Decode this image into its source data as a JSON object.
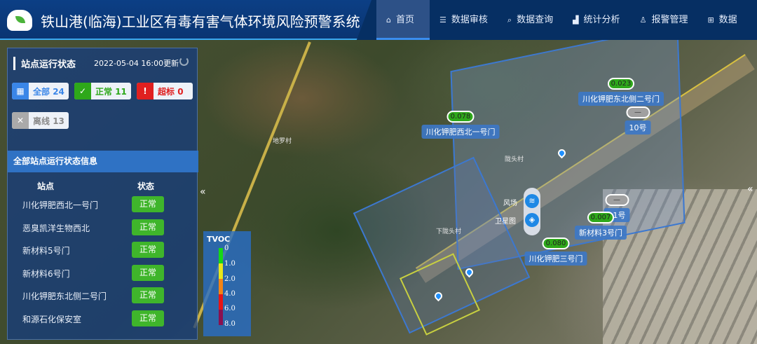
{
  "header": {
    "title": "铁山港(临海)工业区有毒有害气体环境风险预警系统",
    "nav": [
      {
        "label": "首页",
        "icon": "home-icon"
      },
      {
        "label": "数据审核",
        "icon": "list-icon"
      },
      {
        "label": "数据查询",
        "icon": "search-icon"
      },
      {
        "label": "统计分析",
        "icon": "chart-icon"
      },
      {
        "label": "报警管理",
        "icon": "alarm-icon"
      },
      {
        "label": "数据",
        "icon": "table-icon"
      }
    ]
  },
  "panel": {
    "title": "站点运行状态",
    "updated": "2022-05-04 16:00更新",
    "badges": {
      "all": {
        "label": "全部",
        "count": "24"
      },
      "normal": {
        "label": "正常",
        "count": "11"
      },
      "over": {
        "label": "超标",
        "count": "0"
      },
      "offline": {
        "label": "离线",
        "count": "13"
      }
    },
    "section": "全部站点运行状态信息",
    "col_station": "站点",
    "col_status": "状态",
    "rows": [
      {
        "name": "川化钾肥西北一号门",
        "status": "正常"
      },
      {
        "name": "恶臭凯洋生物西北",
        "status": "正常"
      },
      {
        "name": "新材料5号门",
        "status": "正常"
      },
      {
        "name": "新材料6号门",
        "status": "正常"
      },
      {
        "name": "川化钾肥东北侧二号门",
        "status": "正常"
      },
      {
        "name": "和源石化保安室",
        "status": "正常"
      }
    ]
  },
  "legend": {
    "title": "TVOC",
    "ticks": [
      "0",
      "1.0",
      "2.0",
      "4.0",
      "6.0",
      "8.0"
    ],
    "colors": [
      "#16d816",
      "#e8e81a",
      "#f48414",
      "#e81414",
      "#8a1050"
    ]
  },
  "map": {
    "villages": [
      "地罗村",
      "陇头村",
      "下陇头村"
    ],
    "markers": [
      {
        "value": "0.078",
        "name": "川化钾肥西北一号门"
      },
      {
        "value": "0.023",
        "name": "川化钾肥东北侧二号门"
      },
      {
        "value": "—",
        "name": "10号"
      },
      {
        "value": "—",
        "name": "11号"
      },
      {
        "value": "0.007",
        "name": "新材料3号门"
      },
      {
        "value": "0.080",
        "name": "川化钾肥三号门"
      }
    ],
    "controls": {
      "wind": "风场",
      "satellite": "卫星图"
    }
  }
}
